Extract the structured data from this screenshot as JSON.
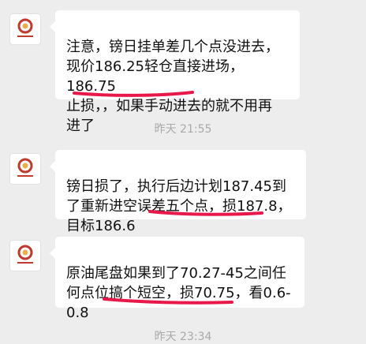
{
  "chat": {
    "messages": [
      {
        "sender_icon": "brand-logo-icon",
        "text": "注意，镑日挂单差几个点没进去，\n现价186.25轻仓直接进场，186.75\n止损，，如果手动进去的就不用再\n进了"
      },
      {
        "sender_icon": "brand-logo-icon",
        "text": "镑日损了，执行后边计划187.45到\n了重新进空误差五个点，损187.8，\n目标186.6"
      },
      {
        "sender_icon": "brand-logo-icon",
        "text": "原油尾盘如果到了70.27-45之间任\n何点位搞个短空，损70.75，看0.6-\n0.8"
      }
    ],
    "timestamps": [
      "昨天 21:55",
      "昨天 23:34"
    ],
    "annotation_color": "#e8194a"
  }
}
